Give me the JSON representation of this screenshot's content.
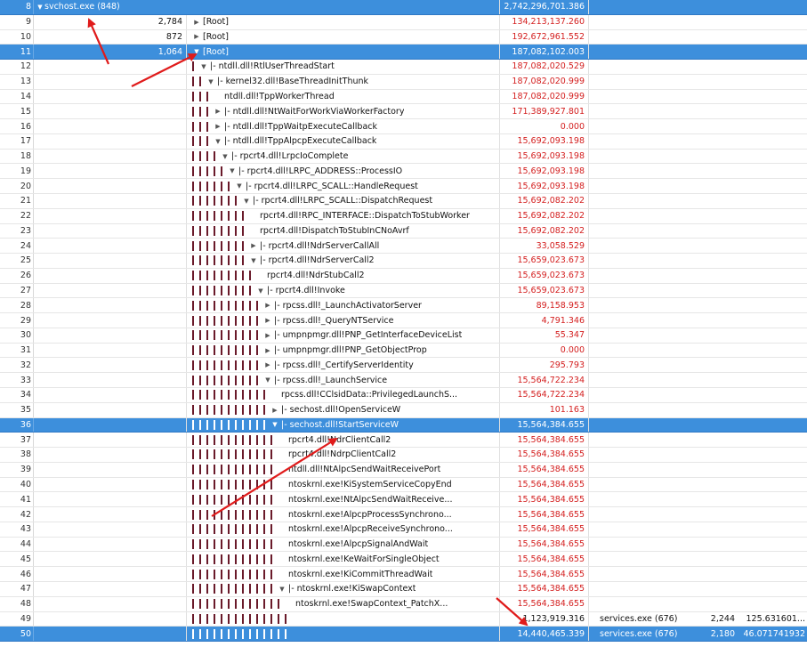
{
  "rows": [
    {
      "num": "8",
      "count": "",
      "depth": 0,
      "toggle": "▼",
      "label": "svchost.exe (848)",
      "value": "2,742,296,701.386",
      "proc": "",
      "cnt2": "",
      "rate": "",
      "selected": true,
      "lead": true
    },
    {
      "num": "9",
      "count": "2,784",
      "depth": 0,
      "toggle": "▶",
      "label": "[Root]",
      "value": "134,213,137.260",
      "proc": "",
      "cnt2": "",
      "rate": "",
      "selected": false
    },
    {
      "num": "10",
      "count": "872",
      "depth": 0,
      "toggle": "▶",
      "label": "[Root]",
      "value": "192,672,961.552",
      "proc": "",
      "cnt2": "",
      "rate": "",
      "selected": false
    },
    {
      "num": "11",
      "count": "1,064",
      "depth": 0,
      "toggle": "▼",
      "label": "[Root]",
      "value": "187,082,102.003",
      "proc": "",
      "cnt2": "",
      "rate": "",
      "selected": true
    },
    {
      "num": "12",
      "count": "",
      "depth": 1,
      "toggle": "▼",
      "label": "|- ntdll.dll!RtlUserThreadStart",
      "value": "187,082,020.529",
      "selected": false
    },
    {
      "num": "13",
      "count": "",
      "depth": 2,
      "toggle": "▼",
      "label": "|- kernel32.dll!BaseThreadInitThunk",
      "value": "187,082,020.999",
      "selected": false
    },
    {
      "num": "14",
      "count": "",
      "depth": 3,
      "toggle": "",
      "label": "ntdll.dll!TppWorkerThread",
      "value": "187,082,020.999",
      "selected": false
    },
    {
      "num": "15",
      "count": "",
      "depth": 3,
      "toggle": "▶",
      "label": "|- ntdll.dll!NtWaitForWorkViaWorkerFactory",
      "value": "171,389,927.801",
      "selected": false
    },
    {
      "num": "16",
      "count": "",
      "depth": 3,
      "toggle": "▶",
      "label": "|- ntdll.dll!TppWaitpExecuteCallback",
      "value": "0.000",
      "selected": false
    },
    {
      "num": "17",
      "count": "",
      "depth": 3,
      "toggle": "▼",
      "label": "|- ntdll.dll!TppAlpcpExecuteCallback",
      "value": "15,692,093.198",
      "selected": false
    },
    {
      "num": "18",
      "count": "",
      "depth": 4,
      "toggle": "▼",
      "label": "|- rpcrt4.dll!LrpcIoComplete",
      "value": "15,692,093.198",
      "selected": false
    },
    {
      "num": "19",
      "count": "",
      "depth": 5,
      "toggle": "▼",
      "label": "|- rpcrt4.dll!LRPC_ADDRESS::ProcessIO",
      "value": "15,692,093.198",
      "selected": false
    },
    {
      "num": "20",
      "count": "",
      "depth": 6,
      "toggle": "▼",
      "label": "|- rpcrt4.dll!LRPC_SCALL::HandleRequest",
      "value": "15,692,093.198",
      "selected": false
    },
    {
      "num": "21",
      "count": "",
      "depth": 7,
      "toggle": "▼",
      "label": "|- rpcrt4.dll!LRPC_SCALL::DispatchRequest",
      "value": "15,692,082.202",
      "selected": false
    },
    {
      "num": "22",
      "count": "",
      "depth": 8,
      "toggle": "",
      "label": "rpcrt4.dll!RPC_INTERFACE::DispatchToStubWorker",
      "value": "15,692,082.202",
      "selected": false
    },
    {
      "num": "23",
      "count": "",
      "depth": 8,
      "toggle": "",
      "label": "rpcrt4.dll!DispatchToStubInCNoAvrf",
      "value": "15,692,082.202",
      "selected": false
    },
    {
      "num": "24",
      "count": "",
      "depth": 8,
      "toggle": "▶",
      "label": "|- rpcrt4.dll!NdrServerCallAll",
      "value": "33,058.529",
      "selected": false
    },
    {
      "num": "25",
      "count": "",
      "depth": 8,
      "toggle": "▼",
      "label": "|- rpcrt4.dll!NdrServerCall2",
      "value": "15,659,023.673",
      "selected": false
    },
    {
      "num": "26",
      "count": "",
      "depth": 9,
      "toggle": "",
      "label": "rpcrt4.dll!NdrStubCall2",
      "value": "15,659,023.673",
      "selected": false
    },
    {
      "num": "27",
      "count": "",
      "depth": 9,
      "toggle": "▼",
      "label": "|- rpcrt4.dll!Invoke",
      "value": "15,659,023.673",
      "selected": false
    },
    {
      "num": "28",
      "count": "",
      "depth": 10,
      "toggle": "▶",
      "label": "|- rpcss.dll!_LaunchActivatorServer",
      "value": "89,158.953",
      "selected": false
    },
    {
      "num": "29",
      "count": "",
      "depth": 10,
      "toggle": "▶",
      "label": "|- rpcss.dll!_QueryNTService",
      "value": "4,791.346",
      "selected": false
    },
    {
      "num": "30",
      "count": "",
      "depth": 10,
      "toggle": "▶",
      "label": "|- umpnpmgr.dll!PNP_GetInterfaceDeviceList",
      "value": "55.347",
      "selected": false
    },
    {
      "num": "31",
      "count": "",
      "depth": 10,
      "toggle": "▶",
      "label": "|- umpnpmgr.dll!PNP_GetObjectProp",
      "value": "0.000",
      "selected": false
    },
    {
      "num": "32",
      "count": "",
      "depth": 10,
      "toggle": "▶",
      "label": "|- rpcss.dll!_CertifyServerIdentity",
      "value": "295.793",
      "selected": false
    },
    {
      "num": "33",
      "count": "",
      "depth": 10,
      "toggle": "▼",
      "label": "|- rpcss.dll!_LaunchService",
      "value": "15,564,722.234",
      "selected": false
    },
    {
      "num": "34",
      "count": "",
      "depth": 11,
      "toggle": "",
      "label": "rpcss.dll!CClsidData::PrivilegedLaunchS...",
      "value": "15,564,722.234",
      "selected": false
    },
    {
      "num": "35",
      "count": "",
      "depth": 11,
      "toggle": "▶",
      "label": "|- sechost.dll!OpenServiceW",
      "value": "101.163",
      "selected": false
    },
    {
      "num": "36",
      "count": "",
      "depth": 11,
      "toggle": "▼",
      "label": "|- sechost.dll!StartServiceW",
      "value": "15,564,384.655",
      "selected": true
    },
    {
      "num": "37",
      "count": "",
      "depth": 12,
      "toggle": "",
      "label": "rpcrt4.dll!NdrClientCall2",
      "value": "15,564,384.655",
      "selected": false
    },
    {
      "num": "38",
      "count": "",
      "depth": 12,
      "toggle": "",
      "label": "rpcrt4.dll!NdrpClientCall2",
      "value": "15,564,384.655",
      "selected": false
    },
    {
      "num": "39",
      "count": "",
      "depth": 12,
      "toggle": "",
      "label": "ntdll.dll!NtAlpcSendWaitReceivePort",
      "value": "15,564,384.655",
      "selected": false
    },
    {
      "num": "40",
      "count": "",
      "depth": 12,
      "toggle": "",
      "label": "ntoskrnl.exe!KiSystemServiceCopyEnd",
      "value": "15,564,384.655",
      "selected": false
    },
    {
      "num": "41",
      "count": "",
      "depth": 12,
      "toggle": "",
      "label": "ntoskrnl.exe!NtAlpcSendWaitReceive...",
      "value": "15,564,384.655",
      "selected": false
    },
    {
      "num": "42",
      "count": "",
      "depth": 12,
      "toggle": "",
      "label": "ntoskrnl.exe!AlpcpProcessSynchrono...",
      "value": "15,564,384.655",
      "selected": false
    },
    {
      "num": "43",
      "count": "",
      "depth": 12,
      "toggle": "",
      "label": "ntoskrnl.exe!AlpcpReceiveSynchrono...",
      "value": "15,564,384.655",
      "selected": false
    },
    {
      "num": "44",
      "count": "",
      "depth": 12,
      "toggle": "",
      "label": "ntoskrnl.exe!AlpcpSignalAndWait",
      "value": "15,564,384.655",
      "selected": false
    },
    {
      "num": "45",
      "count": "",
      "depth": 12,
      "toggle": "",
      "label": "ntoskrnl.exe!KeWaitForSingleObject",
      "value": "15,564,384.655",
      "selected": false
    },
    {
      "num": "46",
      "count": "",
      "depth": 12,
      "toggle": "",
      "label": "ntoskrnl.exe!KiCommitThreadWait",
      "value": "15,564,384.655",
      "selected": false
    },
    {
      "num": "47",
      "count": "",
      "depth": 12,
      "toggle": "▼",
      "label": "|- ntoskrnl.exe!KiSwapContext",
      "value": "15,564,384.655",
      "selected": false
    },
    {
      "num": "48",
      "count": "",
      "depth": 13,
      "toggle": "",
      "label": "ntoskrnl.exe!SwapContext_PatchX...",
      "value": "15,564,384.655",
      "selected": false
    },
    {
      "num": "49",
      "count": "",
      "depth": 14,
      "toggle": "",
      "label": "",
      "value": "1,123,919.316",
      "proc": "services.exe (676)",
      "cnt2": "2,244",
      "rate": "125.631601...",
      "selected": false,
      "blackval": true
    },
    {
      "num": "50",
      "count": "",
      "depth": 14,
      "toggle": "",
      "label": "",
      "value": "14,440,465.339",
      "proc": "services.exe (676)",
      "cnt2": "2,180",
      "rate": "46.071741932",
      "selected": true
    }
  ],
  "colors": {
    "selection": "#3d8fdc",
    "value_red": "#d42020",
    "tree_bar": "#6a1a2a",
    "annotation_arrow": "#e01b1b"
  }
}
